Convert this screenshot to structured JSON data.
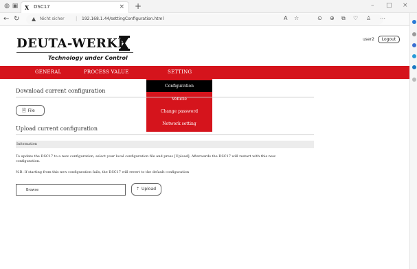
{
  "browser": {
    "tab_title": "DSC17",
    "tab_close": "×",
    "new_tab": "+",
    "not_secure": "Nicht sicher",
    "url": "192.168.1.44/settingConfiguration.html",
    "win_min": "–",
    "win_max": "□",
    "win_close": "×"
  },
  "header": {
    "brand": "DEUTA-WERKE",
    "tagline": "Technology under Control",
    "username": "user2",
    "logout_label": "Logout"
  },
  "menu": {
    "items": [
      "GENERAL",
      "PROCESS VALUE",
      "SETTING"
    ],
    "dropdown": [
      "Configuration",
      "Vehicle",
      "Change password",
      "Network setting"
    ]
  },
  "content": {
    "download_title": "Download current configuration",
    "file_button": "File",
    "upload_title": "Upload current configuration",
    "info_title": "Information",
    "info_text": "To update the DSC17 to a new configuration, select your local configuration file and press [Upload]. Afterwards the DSC17 will restart with this new configuration.",
    "note_text": "N.B: If starting from this new configuration fails, the DSC17 will revert to the default configuration",
    "browse_label": "Browse",
    "upload_button": "Upload"
  },
  "colors": {
    "brand_red": "#d5141c",
    "active_item": "#000000"
  }
}
